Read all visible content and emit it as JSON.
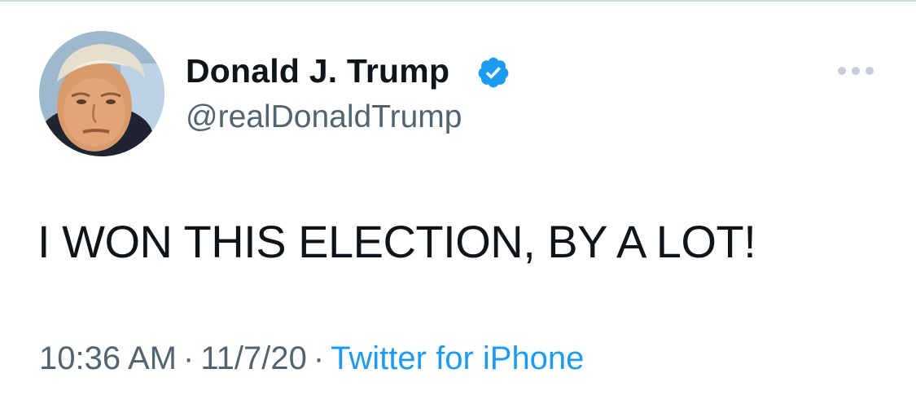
{
  "tweet": {
    "author": {
      "display_name": "Donald J. Trump",
      "handle": "@realDonaldTrump",
      "verified": true,
      "avatar_icon": "profile-photo"
    },
    "text": "I WON THIS ELECTION, BY A LOT!",
    "time": "10:36 AM",
    "date": "11/7/20",
    "separator": "·",
    "source": "Twitter for iPhone",
    "more_icon": "more-horizontal-icon"
  },
  "colors": {
    "primary_text": "#0f1419",
    "secondary_text": "#536471",
    "link": "#1d9bf0",
    "verified_badge": "#1d9bf0",
    "more_dots": "#c5ced6",
    "divider": "#cfd9de"
  }
}
